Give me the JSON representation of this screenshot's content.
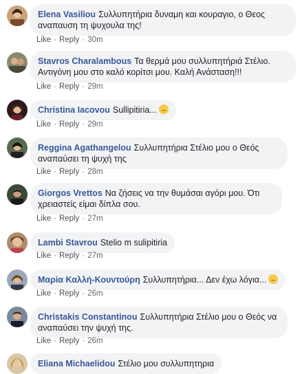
{
  "comments": [
    {
      "name": "Elena Vasiliou",
      "text": "Συλλυπητήρια δυναμη και κουραγιο, ο Θεος αναπαυση τη ψυχουλα της!",
      "like": "Like",
      "reply": "Reply",
      "time": "30m",
      "emoji": false
    },
    {
      "name": "Stavros Charalambous",
      "text": "Τα θερμά μου συλλυπητήριά Στέλιο. Αντιγόνη μου στο καλό κορίτσι μου. Καλή Ανάσταση!!!",
      "like": "Like",
      "reply": "Reply",
      "time": "29m",
      "emoji": false
    },
    {
      "name": "Christina Iacovou",
      "text": "Sullipitiria...",
      "like": "Like",
      "reply": "Reply",
      "time": "29m",
      "emoji": true
    },
    {
      "name": "Reggina Agathangelou",
      "text": "Συλλυπητήρια Στέλιο μου ο Θεός αναπαύσει τη ψυχή της",
      "like": "Like",
      "reply": "Reply",
      "time": "28m",
      "emoji": false
    },
    {
      "name": "Giorgos Vrettos",
      "text": "Να ζήσεις να την θυμάσαι αγόρι μου. Ότι χρειαστείς είμαι δίπλα σου.",
      "like": "Like",
      "reply": "Reply",
      "time": "27m",
      "emoji": false
    },
    {
      "name": "Lambi Stavrou",
      "text": "Stelio m sulipitiria",
      "like": "Like",
      "reply": "Reply",
      "time": "27m",
      "emoji": false
    },
    {
      "name": "Μαρία Καλλή-Κουντούρη",
      "text": "Συλλυπητήρια... Δεν έχω λόγια...",
      "like": "Like",
      "reply": "Reply",
      "time": "26m",
      "emoji": true
    },
    {
      "name": "Christakis Constantinou",
      "text": "Συλλυπητήρια Στέλιο μου ο Θεός να αναπαύσει την ψυχή της.",
      "like": "Like",
      "reply": "Reply",
      "time": "26m",
      "emoji": false
    },
    {
      "name": "Eliana Michaelidou",
      "text": "Στέλιο μου συλλυπητηρια",
      "like": "",
      "reply": "",
      "time": "",
      "emoji": false
    }
  ]
}
